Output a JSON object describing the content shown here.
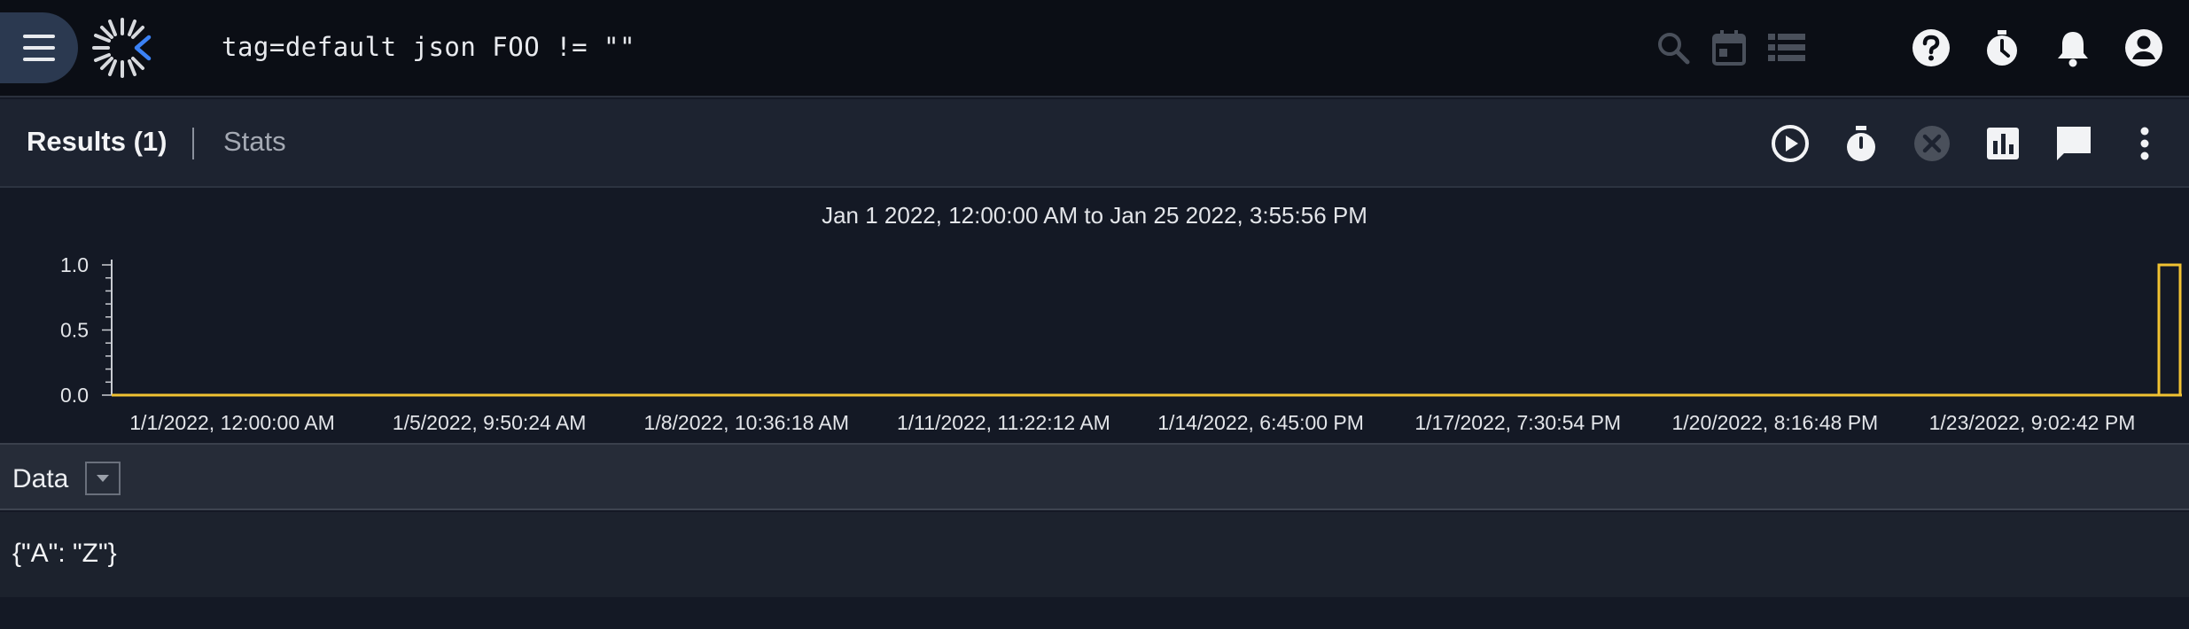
{
  "topbar": {
    "query": "tag=default json FOO != \"\"",
    "icons": {
      "menu": "hamburger-menu-icon",
      "logo": "app-logo",
      "search": "search-icon",
      "calendar": "calendar-icon",
      "list": "list-icon",
      "help": "help-icon",
      "timer": "timer-icon",
      "notifications": "bell-icon",
      "account": "account-icon"
    }
  },
  "results_bar": {
    "results_tab": "Results (1)",
    "stats_tab": "Stats",
    "icons": [
      "play-icon",
      "stopwatch-icon",
      "cancel-icon",
      "chart-icon",
      "comment-icon",
      "more-vert-icon"
    ]
  },
  "chart_data": {
    "type": "bar",
    "title": "Jan 1 2022, 12:00:00 AM to Jan 25 2022, 3:55:56 PM",
    "x_tick_labels": [
      "1/1/2022, 12:00:00 AM",
      "1/5/2022, 9:50:24 AM",
      "1/8/2022, 10:36:18 AM",
      "1/11/2022, 11:22:12 AM",
      "1/14/2022, 6:45:00 PM",
      "1/17/2022, 7:30:54 PM",
      "1/20/2022, 8:16:48 PM",
      "1/23/2022, 9:02:42 PM"
    ],
    "y_tick_labels": [
      "1.0",
      "0.5",
      "0.0"
    ],
    "ylim": [
      0,
      1
    ],
    "bars": [
      {
        "start": "1/25/2022, 2:30:00 PM",
        "end": "1/25/2022, 3:55:56 PM",
        "count": 1
      }
    ],
    "bar_color": "#f1c232",
    "grid": false
  },
  "data_section": {
    "header_label": "Data",
    "rows": [
      "{\"A\": \"Z\"}"
    ]
  },
  "colors": {
    "accent": "#f1c232",
    "logo_accent": "#3b82f6",
    "background": "#141925"
  }
}
